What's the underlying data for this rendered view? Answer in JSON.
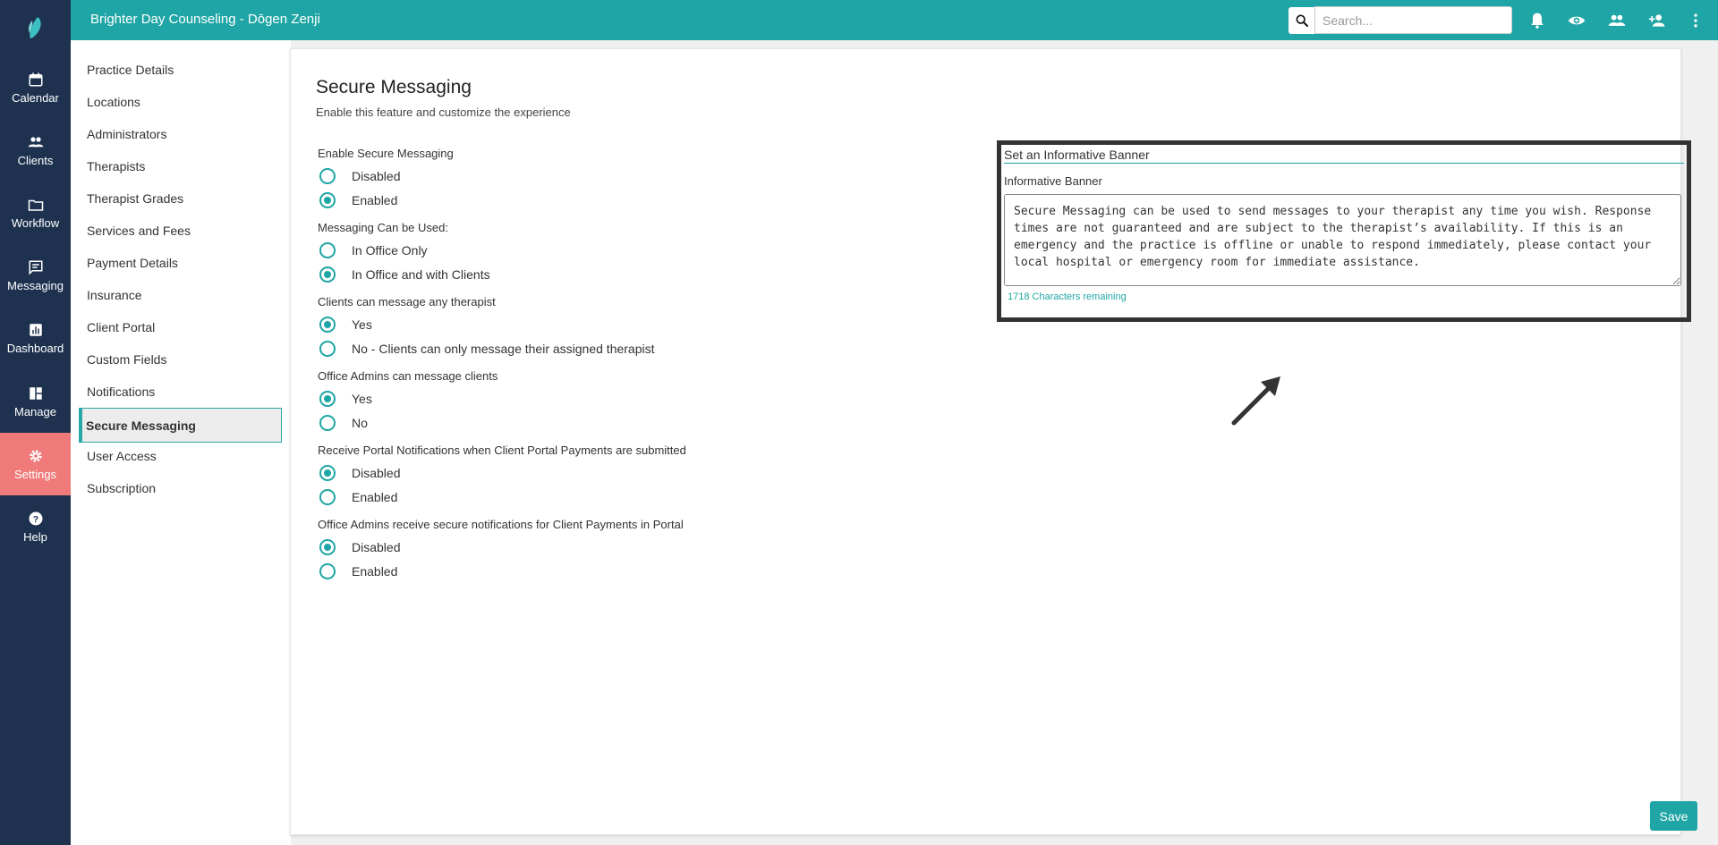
{
  "topbar": {
    "title": "Brighter Day Counseling - Dōgen Zenji",
    "search_placeholder": "Search..."
  },
  "rail": {
    "items": [
      {
        "label": "Calendar",
        "icon": "calendar-icon"
      },
      {
        "label": "Clients",
        "icon": "clients-icon"
      },
      {
        "label": "Workflow",
        "icon": "folder-icon"
      },
      {
        "label": "Messaging",
        "icon": "message-icon"
      },
      {
        "label": "Dashboard",
        "icon": "chart-icon"
      },
      {
        "label": "Manage",
        "icon": "grid-icon"
      },
      {
        "label": "Settings",
        "icon": "gear-icon"
      },
      {
        "label": "Help",
        "icon": "help-icon"
      }
    ],
    "active": "Settings",
    "active_color": "#f07a7a"
  },
  "menu": {
    "items": [
      "Practice Details",
      "Locations",
      "Administrators",
      "Therapists",
      "Therapist Grades",
      "Services and Fees",
      "Payment Details",
      "Insurance",
      "Client Portal",
      "Custom Fields",
      "Notifications",
      "Secure Messaging",
      "User Access",
      "Subscription"
    ],
    "active": "Secure Messaging"
  },
  "main": {
    "title": "Secure Messaging",
    "subtitle": "Enable this feature and customize the experience",
    "questions": [
      {
        "label": "Enable Secure Messaging",
        "options": [
          "Disabled",
          "Enabled"
        ],
        "selected": "Enabled"
      },
      {
        "label": "Messaging Can be Used:",
        "options": [
          "In Office Only",
          "In Office and with Clients"
        ],
        "selected": "In Office and with Clients"
      },
      {
        "label": "Clients can message any therapist",
        "options": [
          "Yes",
          "No - Clients can only message their assigned therapist"
        ],
        "selected": "Yes"
      },
      {
        "label": "Office Admins can message clients",
        "options": [
          "Yes",
          "No"
        ],
        "selected": "Yes"
      },
      {
        "label": "Receive Portal Notifications when Client Portal Payments are submitted",
        "options": [
          "Disabled",
          "Enabled"
        ],
        "selected": "Disabled"
      },
      {
        "label": "Office Admins receive secure notifications for Client Payments in Portal",
        "options": [
          "Disabled",
          "Enabled"
        ],
        "selected": "Disabled"
      }
    ],
    "banner": {
      "heading": "Set an Informative Banner",
      "label": "Informative Banner",
      "text": "Secure Messaging can be used to send messages to your therapist any time you wish. Response times are not guaranteed and are subject to the therapist’s availability. If this is an emergency and the practice is offline or unable to respond immediately, please contact your local hospital or emergency room for immediate assistance.",
      "count": "1718 Characters remaining"
    },
    "save_label": "Save"
  },
  "colors": {
    "accent": "#1fa5a5",
    "rail_bg": "#1e3250"
  }
}
